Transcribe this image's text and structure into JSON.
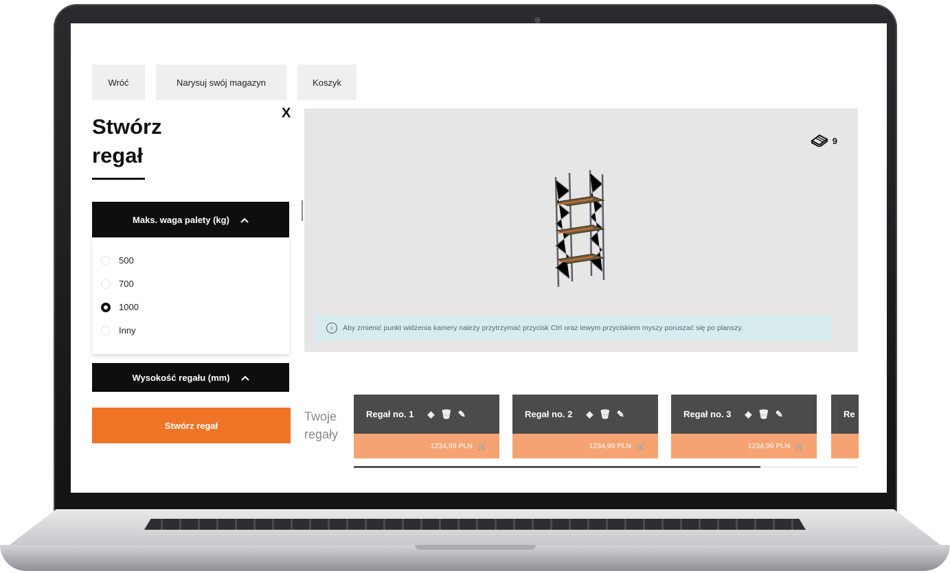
{
  "nav": {
    "back_label": "Wróć",
    "draw_label": "Narysuj swój magazyn",
    "cart_label": "Koszyk"
  },
  "panel": {
    "close_label": "X",
    "title_line1": "Stwórz",
    "title_line2": "regał",
    "weight_header": "Maks. waga palety (kg)",
    "weight_options": [
      "500",
      "700",
      "1000",
      "Inny"
    ],
    "weight_selected": "1000",
    "height_header": "Wysokość regału (mm)",
    "create_button": "Stwórz regał"
  },
  "viewer": {
    "pallet_count": "9",
    "hint": "Aby zmienić punkt widzenia kamery należy przytrzymać przycisk Ctrl oraz lewym przyciskiem myszy poruszać się po planszy."
  },
  "racks": {
    "label_line1": "Twoje",
    "label_line2": "regały",
    "items": [
      {
        "name": "Regał no. 1",
        "price": "1234,99 PLN"
      },
      {
        "name": "Regał no. 2",
        "price": "1234,99 PLN"
      },
      {
        "name": "Regał no. 3",
        "price": "1234,99 PLN"
      }
    ],
    "partial_name": "Re"
  },
  "colors": {
    "accent": "#f07425",
    "price_bg": "#f5a372",
    "card_head": "#4b4b4b",
    "hint_bg": "#d8ecef"
  }
}
